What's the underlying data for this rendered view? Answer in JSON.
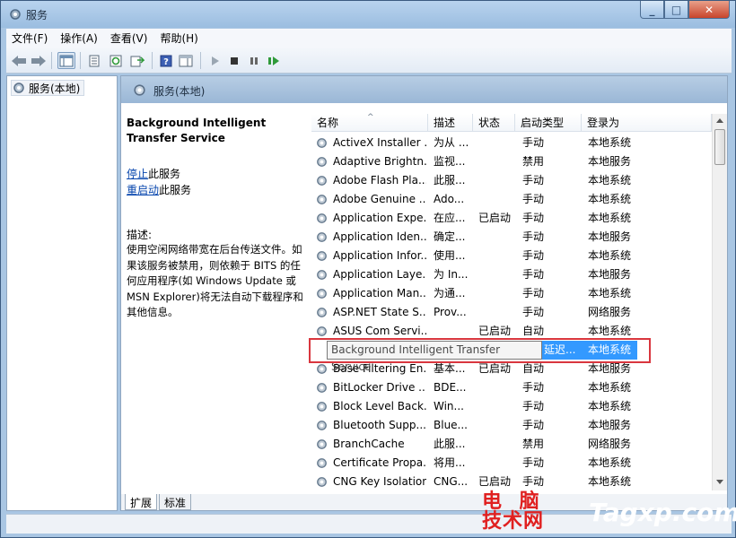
{
  "window": {
    "title": "服务"
  },
  "menu": [
    "文件(F)",
    "操作(A)",
    "查看(V)",
    "帮助(H)"
  ],
  "tree": {
    "item": "服务(本地)"
  },
  "main": {
    "header": "服务(本地)"
  },
  "desc": {
    "title": "Background Intelligent Transfer Service",
    "stop_link": "停止",
    "stop_suffix": "此服务",
    "restart_link": "重启动",
    "restart_suffix": "此服务",
    "label": "描述:",
    "body": "使用空闲网络带宽在后台传送文件。如果该服务被禁用，则依赖于 BITS 的任何应用程序(如 Windows Update 或 MSN Explorer)将无法自动下载程序和其他信息。"
  },
  "columns": [
    "名称",
    "描述",
    "状态",
    "启动类型",
    "登录为"
  ],
  "rows": [
    {
      "name": "ActiveX Installer ...",
      "desc": "为从 ...",
      "status": "",
      "startup": "手动",
      "logon": "本地系统"
    },
    {
      "name": "Adaptive Brightn...",
      "desc": "监视...",
      "status": "",
      "startup": "禁用",
      "logon": "本地服务"
    },
    {
      "name": "Adobe Flash Pla...",
      "desc": "此服...",
      "status": "",
      "startup": "手动",
      "logon": "本地系统"
    },
    {
      "name": "Adobe Genuine ...",
      "desc": "Ado...",
      "status": "",
      "startup": "手动",
      "logon": "本地系统"
    },
    {
      "name": "Application Expe...",
      "desc": "在应...",
      "status": "已启动",
      "startup": "手动",
      "logon": "本地系统"
    },
    {
      "name": "Application Iden...",
      "desc": "确定...",
      "status": "",
      "startup": "手动",
      "logon": "本地服务"
    },
    {
      "name": "Application Infor...",
      "desc": "使用...",
      "status": "",
      "startup": "手动",
      "logon": "本地系统"
    },
    {
      "name": "Application Laye...",
      "desc": "为 In...",
      "status": "",
      "startup": "手动",
      "logon": "本地服务"
    },
    {
      "name": "Application Man...",
      "desc": "为通...",
      "status": "",
      "startup": "手动",
      "logon": "本地系统"
    },
    {
      "name": "ASP.NET State S...",
      "desc": "Prov...",
      "status": "",
      "startup": "手动",
      "logon": "网络服务"
    },
    {
      "name": "ASUS Com Servi...",
      "desc": "",
      "status": "已启动",
      "startup": "自动",
      "logon": "本地系统"
    },
    {
      "name": "",
      "desc": "",
      "status": "",
      "startup": "",
      "logon": ""
    },
    {
      "name": "Base Filtering En...",
      "desc": "基本...",
      "status": "已启动",
      "startup": "自动",
      "logon": "本地服务"
    },
    {
      "name": "BitLocker Drive ...",
      "desc": "BDE...",
      "status": "",
      "startup": "手动",
      "logon": "本地系统"
    },
    {
      "name": "Block Level Back...",
      "desc": "Win...",
      "status": "",
      "startup": "手动",
      "logon": "本地系统"
    },
    {
      "name": "Bluetooth Supp...",
      "desc": "Blue...",
      "status": "",
      "startup": "手动",
      "logon": "本地服务"
    },
    {
      "name": "BranchCache",
      "desc": "此服...",
      "status": "",
      "startup": "禁用",
      "logon": "网络服务"
    },
    {
      "name": "Certificate Propa...",
      "desc": "将用...",
      "status": "",
      "startup": "手动",
      "logon": "本地系统"
    },
    {
      "name": "CNG Key Isolation",
      "desc": "CNG...",
      "status": "已启动",
      "startup": "手动",
      "logon": "本地系统"
    }
  ],
  "selected_row": {
    "name": "Background Intelligent Transfer Service",
    "startup": "延迟...",
    "logon": "本地系统"
  },
  "tabs": [
    "扩展",
    "标准"
  ],
  "watermark": {
    "line1": "电 脑",
    "line2": "技术网",
    "brand": "Tagxp.com"
  }
}
